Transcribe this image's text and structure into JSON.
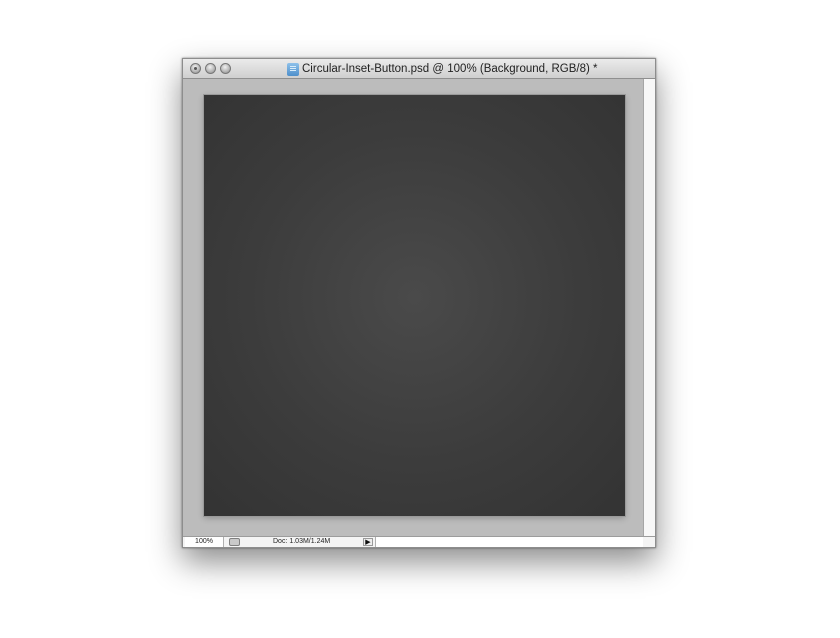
{
  "window": {
    "title": "Circular-Inset-Button.psd @ 100% (Background, RGB/8) *",
    "file_icon": "psd-file-icon",
    "controls": [
      "close-icon",
      "minimize-icon",
      "zoom-icon"
    ]
  },
  "canvas": {
    "background_color": "#3d3d3d",
    "gradient_center_color": "#4a4a4a",
    "pasteboard_color": "#bcbcbc"
  },
  "statusbar": {
    "zoom": "100%",
    "doc_info": "Doc: 1.03M/1.24M",
    "arrow": "▶"
  }
}
